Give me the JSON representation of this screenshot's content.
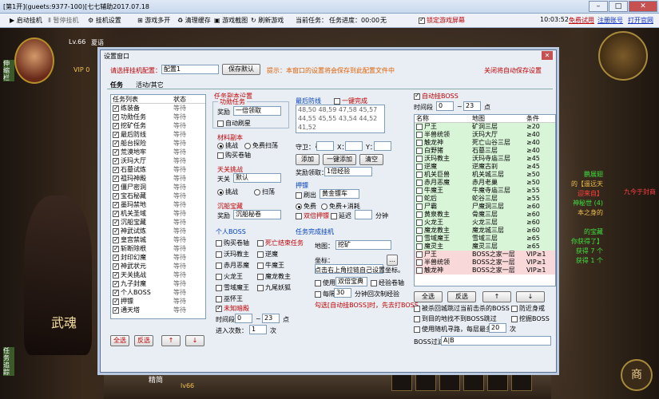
{
  "window": {
    "title": "[第1开](gueets:9377-100)[七七辅助2017.07.18"
  },
  "toolbar": {
    "start": "启动挂机",
    "pause": "暂停挂机",
    "settings": "挂机设置",
    "multi": "游戏多开",
    "clear_cache": "清理缓存",
    "screenshot": "游戏截图",
    "refresh": "刷新游戏",
    "current_task_label": "当前任务：",
    "progress_label": "任务进度：00:00",
    "none": "无",
    "lock": "锁定游戏屏幕",
    "time": "10:03:52",
    "trial": "免费试用",
    "register": "注册账号",
    "open_site": "打开官网"
  },
  "game": {
    "level": "Lv.66",
    "name": "夏语",
    "side_tab": "伸缩栏",
    "side_tab2": "任务追踪",
    "vip": "VIP 0",
    "bottom_label": "精简",
    "bottom_level": "lv66",
    "r_label": "商",
    "chat": [
      "鹏展翅",
      "的【遥远天",
      "迎来自】",
      "神秘世 (4)",
      "本之身的",
      "九今于封商",
      "的宝藏",
      "你获得了】",
      "获得 7 个",
      "获得 1 个"
    ],
    "banner": "武魂"
  },
  "dialog": {
    "title": "设置窗口",
    "select_label": "请选择挂机配置：",
    "select_value": "配置1",
    "save_btn": "保存默认",
    "hint": "提示：本窗口的设置将会保存到此配置文件中",
    "close_save": "关闭将自动保存设置",
    "tabs": [
      "任务",
      "活动/其它"
    ],
    "task_list": {
      "col_name": "任务列表",
      "col_state": "状态",
      "items": [
        "练装备",
        "功勋任务",
        "挖矿任务",
        "最后防线",
        "船台探险",
        "荒漠地牢",
        "沃玛大厅",
        "石墓试炼",
        "祖玛神殿",
        "僵尸密洞",
        "宝石秘藏",
        "墨玛禁地",
        "机关圣域",
        "沉船宝藏",
        "神武试炼",
        "皇宫禁城",
        "斩断除根",
        "封印幻魔",
        "神武状元",
        "天关挑战",
        "九子封魔",
        "个人BOSS",
        "押镖",
        "通天塔"
      ],
      "state": "等待"
    },
    "task_buttons": {
      "select_all": "全选",
      "invert": "反选",
      "up": "↑",
      "down": "↓"
    },
    "fuben": {
      "title": "任务副本设置",
      "gongxun": "功勋任务",
      "reward_label": "奖励",
      "reward_value": "一倍领取",
      "auto_refresh": "自动刷星",
      "cailiao": "材料副本",
      "challenge": "挑战",
      "free_sweep": "免费扫荡",
      "buy_roll": "购买卷轴",
      "tianguan": "天关挑战",
      "tianguan_label": "天关",
      "tianguan_value": "默认",
      "challenge2": "挑战",
      "sweep": "扫荡",
      "chenchuan": "沉船宝藏",
      "chen_reward": "奖励",
      "chen_value": "沉船秘卷"
    },
    "last_line": {
      "title": "最后防线",
      "one_key": "一键完成",
      "nums": [
        "48,50",
        "48,59",
        "47,58",
        "45,57",
        "44,55",
        "45,55",
        "43,54",
        "44,52",
        "41,52"
      ],
      "guard": "守卫：弓",
      "x": "X：",
      "y": "Y：",
      "add": "添加",
      "one_add": "一键添加",
      "clear": "清空",
      "reward": "奖励领取：",
      "reward_value": "1倍经验"
    },
    "escort": {
      "title": "押镖",
      "refresh": "刷出",
      "refresh_value": "黄金镖车",
      "free": "免费",
      "free_cost": "免费+消耗",
      "double": "双倍押镖",
      "delay": "延迟",
      "minutes": "分钟"
    },
    "personal_boss": {
      "title": "个人BOSS",
      "items": [
        "购买卷轴",
        "沃玛教主",
        "赤月恶魔",
        "火龙王",
        "雪域魔王",
        "巫怀王"
      ],
      "items2": [
        "死亡结束任务",
        "逆魔",
        "牛魔王",
        "魔龙教主",
        "九尾妖狐"
      ]
    },
    "dig": {
      "title": "未知暗殿",
      "period": "时间段",
      "from": "0",
      "to": "23",
      "dot": "点",
      "times_label": "进入次数：",
      "times": "1",
      "ci": "次"
    },
    "finish": {
      "title": "任务完成挂机",
      "map_label": "地图：",
      "map_value": "挖矿",
      "coord_label": "坐标：",
      "coord_hint": "点击右上角拉链自己设置坐标。",
      "use_double": "使用",
      "double_item": "双倍宝典",
      "exp": "经验卷轴",
      "every": "每隔",
      "minutes": "分钟回次制经验",
      "interval": "30",
      "warn": "勾选[自动挂BOSS]时，先去打BOSS"
    },
    "boss": {
      "auto": "自动挂BOSS",
      "period": "时间段",
      "from": "0",
      "to": "23",
      "dot": "点",
      "col_name": "名称",
      "col_map": "地图",
      "col_cond": "条件",
      "rows": [
        [
          "尸王",
          "矿洞三层",
          "≥20"
        ],
        [
          "半兽统领",
          "沃玛大厅",
          "≥40"
        ],
        [
          "触龙神",
          "死亡山谷三层",
          "≥40"
        ],
        [
          "白野猪",
          "石墓三层",
          "≥40"
        ],
        [
          "沃玛教主",
          "沃玛寺庙三层",
          "≥45"
        ],
        [
          "逆魔",
          "逆魔古刹",
          "≥45"
        ],
        [
          "机关巨兽",
          "机关城三层",
          "≥50"
        ],
        [
          "赤月恶魔",
          "赤月老巢",
          "≥50"
        ],
        [
          "牛魔王",
          "牛魔寺庙三层",
          "≥55"
        ],
        [
          "蛇后",
          "蛇谷三层",
          "≥55"
        ],
        [
          "尸霸",
          "尸魔洞三层",
          "≥60"
        ],
        [
          "黄泉教主",
          "骨魔三层",
          "≥60"
        ],
        [
          "火龙王",
          "火龙三层",
          "≥60"
        ],
        [
          "魔龙教主",
          "魔龙城三层",
          "≥60"
        ],
        [
          "雪域魔王",
          "雪域三层",
          "≥65"
        ],
        [
          "魔灵主",
          "魔灵三层",
          "≥65"
        ],
        [
          "尸王",
          "BOSS之家一层",
          "VIP≥1"
        ],
        [
          "半兽统领",
          "BOSS之家一层",
          "VIP≥1"
        ],
        [
          "触龙神",
          "BOSS之家一层",
          "VIP≥1"
        ]
      ],
      "select_all": "全选",
      "invert": "反选",
      "opt1": "被杀回城跳过当前击杀的BOSS",
      "opt1b": "防近身戒",
      "opt2": "到目的地找不到BOSS跳过",
      "opt2b": "挖掘BOSS",
      "opt3": "使用随机寻路，每层最多",
      "opt3v": "20",
      "opt3c": "次",
      "filter_label": "BOSS过滤",
      "filter_value": "A|B"
    }
  }
}
